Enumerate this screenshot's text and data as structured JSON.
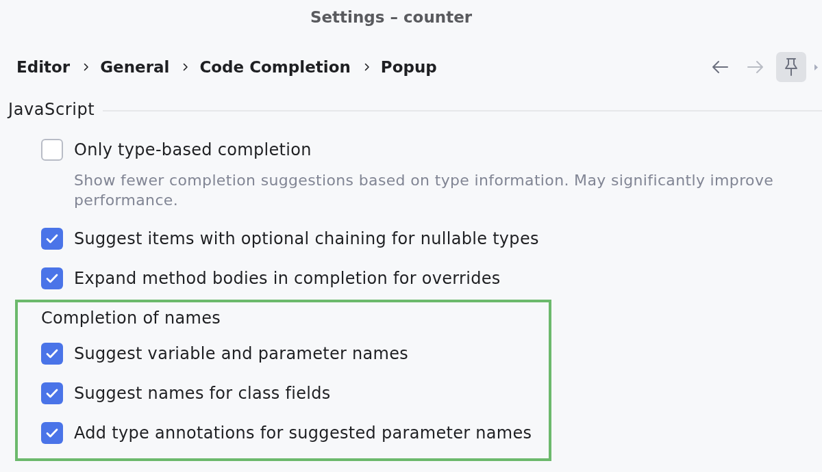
{
  "window": {
    "title": "Settings – counter"
  },
  "breadcrumb": [
    {
      "label": "Editor"
    },
    {
      "label": "General"
    },
    {
      "label": "Code Completion"
    },
    {
      "label": "Popup"
    }
  ],
  "toolbar": {
    "nav_buttons": [
      {
        "kind": "back",
        "disabled": false
      },
      {
        "kind": "forward",
        "disabled": true
      }
    ],
    "pin": {
      "selected": true
    }
  },
  "section": {
    "title": "JavaScript",
    "options": [
      {
        "label": "Only type-based completion",
        "checked": false,
        "description": "Show fewer completion suggestions based on type information. May significantly improve performance."
      },
      {
        "label": "Suggest items with optional chaining for nullable types",
        "checked": true
      },
      {
        "label": "Expand method bodies in completion for overrides",
        "checked": true
      }
    ],
    "group": {
      "title": "Completion of names",
      "highlighted": true,
      "options": [
        {
          "label": "Suggest variable and parameter names",
          "checked": true
        },
        {
          "label": "Suggest names for class fields",
          "checked": true
        },
        {
          "label": "Add type annotations for suggested parameter names",
          "checked": true
        }
      ]
    }
  }
}
